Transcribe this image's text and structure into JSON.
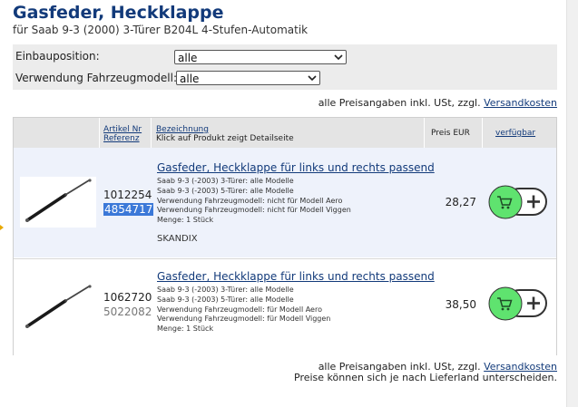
{
  "header": {
    "title": "Gasfeder, Heckklappe",
    "subtitle": "für Saab 9-3 (2000) 3-Türer B204L 4-Stufen-Automatik"
  },
  "filters": {
    "einbauposition_label": "Einbauposition:",
    "einbauposition_value": "alle",
    "verwendung_label": "Verwendung Fahrzeugmodell:",
    "verwendung_value": "alle"
  },
  "price_note_top": {
    "text": "alle Preisangaben inkl. USt, zzgl.",
    "link": "Versandkosten"
  },
  "table": {
    "headers": {
      "artikel_nr": "Artikel Nr",
      "referenz": "Referenz",
      "bezeichnung": "Bezeichnung",
      "bezeichnung_hint": "Klick auf Produkt zeigt Detailseite",
      "preis": "Preis EUR",
      "verfuegbar": "verfügbar"
    },
    "rows": [
      {
        "artikel_nr": "1012254",
        "referenz": "4854717",
        "title": "Gasfeder, Heckklappe für links und rechts passend",
        "details": [
          "Saab 9-3 (-2003) 3-Türer: alle Modelle",
          "Saab 9-3 (-2003) 5-Türer: alle Modelle",
          "Verwendung Fahrzeugmodell: nicht für Modell Aero",
          "Verwendung Fahrzeugmodell: nicht für Modell Viggen",
          "Menge: 1 Stück"
        ],
        "brand": "SKANDIX",
        "price": "28,27",
        "cart_icon": "shopping-cart-plus-icon"
      },
      {
        "artikel_nr": "1062720",
        "referenz": "5022082",
        "title": "Gasfeder, Heckklappe für links und rechts passend",
        "details": [
          "Saab 9-3 (-2003) 3-Türer: alle Modelle",
          "Saab 9-3 (-2003) 5-Türer: alle Modelle",
          "Verwendung Fahrzeugmodell: für Modell Aero",
          "Verwendung Fahrzeugmodell: für Modell Viggen",
          "Menge: 1 Stück"
        ],
        "brand": "",
        "price": "38,50",
        "cart_icon": "shopping-cart-plus-icon"
      }
    ]
  },
  "price_note_bottom": {
    "text": "alle Preisangaben inkl. USt, zzgl.",
    "link": "Versandkosten",
    "line2": "Preise können sich je nach Lieferland unterscheiden."
  },
  "colors": {
    "brand_blue": "#123a7a",
    "cart_green": "#5fe36f",
    "selection_blue": "#3b78d8"
  }
}
